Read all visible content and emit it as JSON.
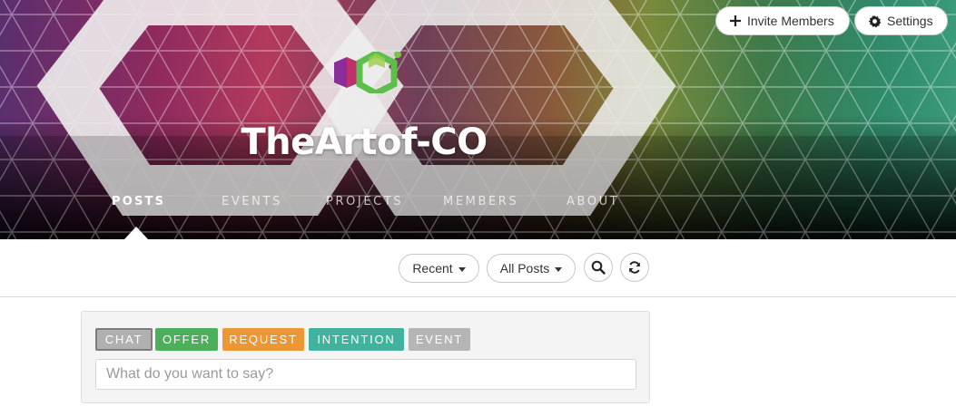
{
  "colors": {
    "chat": "#b0b0b0",
    "offer": "#4caf5a",
    "request": "#eb9736",
    "intention": "#40b29d",
    "event": "#b5b5b5"
  },
  "header": {
    "group_name": "TheArtof-CO",
    "logo": "co-logo-icon",
    "invite_label": "Invite Members",
    "settings_label": "Settings"
  },
  "nav": {
    "tabs": [
      {
        "label": "POSTS",
        "active": true
      },
      {
        "label": "EVENTS",
        "active": false
      },
      {
        "label": "PROJECTS",
        "active": false
      },
      {
        "label": "MEMBERS",
        "active": false
      },
      {
        "label": "ABOUT",
        "active": false
      }
    ]
  },
  "toolbar": {
    "sort_label": "Recent",
    "filter_label": "All Posts",
    "search_icon": "search-icon",
    "refresh_icon": "refresh-icon"
  },
  "composer": {
    "types": [
      {
        "label": "CHAT",
        "selected": true
      },
      {
        "label": "OFFER",
        "selected": false
      },
      {
        "label": "REQUEST",
        "selected": false
      },
      {
        "label": "INTENTION",
        "selected": false
      },
      {
        "label": "EVENT",
        "selected": false
      }
    ],
    "placeholder": "What do you want to say?",
    "value": ""
  }
}
